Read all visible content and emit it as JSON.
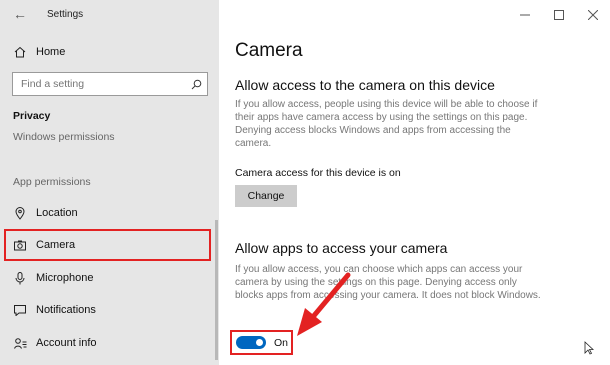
{
  "window": {
    "title": "Settings"
  },
  "sidebar": {
    "home_label": "Home",
    "search_placeholder": "Find a setting",
    "section_privacy": "Privacy",
    "windows_permissions": "Windows permissions",
    "app_permissions": "App permissions",
    "items": [
      {
        "label": "Location",
        "icon": "location-icon",
        "selected": false
      },
      {
        "label": "Camera",
        "icon": "camera-icon",
        "selected": true
      },
      {
        "label": "Microphone",
        "icon": "microphone-icon",
        "selected": false
      },
      {
        "label": "Notifications",
        "icon": "notifications-icon",
        "selected": false
      },
      {
        "label": "Account info",
        "icon": "account-info-icon",
        "selected": false
      }
    ]
  },
  "main": {
    "page_title": "Camera",
    "device_section": {
      "heading": "Allow access to the camera on this device",
      "description": "If you allow access, people using this device will be able to choose if their apps have camera access by using the settings on this page. Denying access blocks Windows and apps from accessing the camera.",
      "status": "Camera access for this device is on",
      "change_button": "Change"
    },
    "apps_section": {
      "heading": "Allow apps to access your camera",
      "description": "If you allow access, you can choose which apps can access your camera by using the settings on this page. Denying access only blocks apps from accessing your camera. It does not block Windows.",
      "toggle_state": "On",
      "toggle_on": true
    }
  },
  "colors": {
    "accent": "#0067c0",
    "highlight": "#e32222",
    "sidebar_bg": "#e6e6e6"
  }
}
